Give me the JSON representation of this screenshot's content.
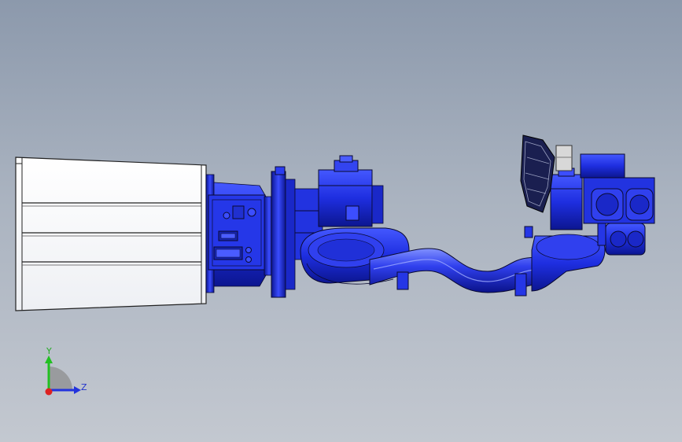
{
  "viewport": {
    "background_top": "#8c99ac",
    "background_bottom": "#c3c8d0",
    "model_color": "#1f2fd8",
    "model_highlight": "#5a6cff",
    "model_shadow": "#0a1290",
    "outline_color": "#0a0a30"
  },
  "triad": {
    "y_label": "Y",
    "z_label": "Z",
    "y_color": "#22c022",
    "z_color": "#2233dd",
    "x_color": "#dd2222"
  },
  "model": {
    "name_icon": "robot-arm-cad-model",
    "end_housing_color": "#ffffff"
  }
}
